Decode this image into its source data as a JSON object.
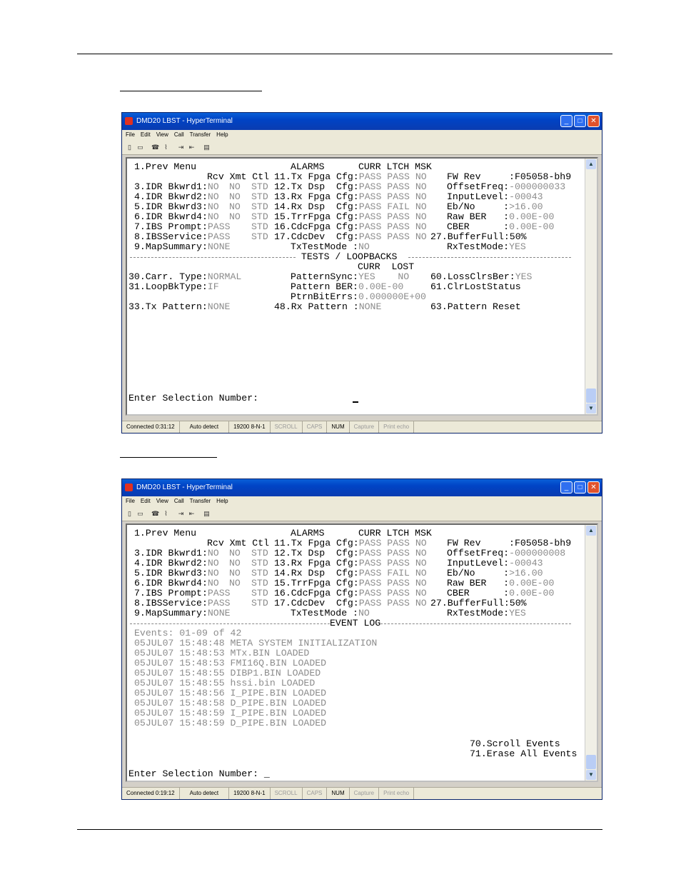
{
  "window1": {
    "title": "DMD20 LBST - HyperTerminal",
    "menu": [
      "File",
      "Edit",
      "View",
      "Call",
      "Transfer",
      "Help"
    ],
    "lines": {
      "prev_menu": "1.Prev Menu",
      "alarms_header": "ALARMS      CURR LTCH MSK",
      "col_header": "Rcv Xmt Ctl",
      "r3_label": "3.IDR Bkwrd1:",
      "r3_a": "NO",
      "r3_b": "NO",
      "r3_c": "STD",
      "r4_label": "4.IDR Bkwrd2:",
      "r4_a": "NO",
      "r4_b": "NO",
      "r4_c": "STD",
      "r5_label": "5.IDR Bkwrd3:",
      "r5_a": "NO",
      "r5_b": "NO",
      "r5_c": "STD",
      "r6_label": "6.IDR Bkwrd4:",
      "r6_a": "NO",
      "r6_b": "NO",
      "r6_c": "STD",
      "r7_label": "7.IBS Prompt:",
      "r7_a": "PASS",
      "r7_c": "STD",
      "r8_label": "8.IBSService:",
      "r8_a": "PASS",
      "r8_c": "STD",
      "r9_label": "9.MapSummary:",
      "r9_a": "NONE",
      "a11": "11.Tx Fpga Cfg:",
      "a11v": "PASS PASS NO",
      "a12": "12.Tx Dsp  Cfg:",
      "a12v": "PASS PASS NO",
      "a13": "13.Rx Fpga Cfg:",
      "a13v": "PASS PASS NO",
      "a14": "14.Rx Dsp  Cfg:",
      "a14v": "PASS FAIL NO",
      "a15": "15.TrrFpga Cfg:",
      "a15v": "PASS PASS NO",
      "a16": "16.CdcFpga Cfg:",
      "a16v": "PASS PASS NO",
      "a17": "17.CdcDev  Cfg:",
      "a17v": "PASS PASS NO",
      "txtest": "TxTestMode :",
      "txtestv": "NO",
      "fw": "FW Rev     :F05058-bh9",
      "offset": "OffsetFreq:",
      "offsetv": "-000000033",
      "input": "InputLevel:",
      "inputv": "-00043",
      "ebno": "Eb/No     :",
      "ebnov": ">16.00",
      "rawber": "Raw BER   :",
      "rawberv": "0.00E-00",
      "cber": "CBER      :",
      "cberv": "0.00E-00",
      "buffer": "27.BufferFull:",
      "bufferv": "50%",
      "rxtest": "RxTestMode:",
      "rxtestv": "YES",
      "divider": " TESTS / LOOPBACKS ",
      "currlost": "CURR  LOST",
      "carr": "30.Carr. Type:",
      "carrv": "NORMAL",
      "loopbk": "31.LoopBkType:",
      "loopbkv": "IF",
      "txpat": "33.Tx Pattern:",
      "txpatv": "NONE",
      "psync": "PatternSync:",
      "psyncv": "YES    NO",
      "pber": "Pattern BER:",
      "pberv": "0.00E-00",
      "pbit": "PtrnBitErrs:",
      "pbitv": "0.000000E+00",
      "rxpat": "48.Rx Pattern :",
      "rxpatv": "NONE",
      "loss": "60.LossClrsBer:",
      "lossv": "YES",
      "clrlost": "61.ClrLostStatus",
      "patreset": "63.Pattern Reset",
      "prompt": "Enter Selection Number:"
    },
    "status": [
      "Connected 0:31:12",
      "Auto detect",
      "19200 8-N-1",
      "SCROLL",
      "CAPS",
      "NUM",
      "Capture",
      "Print echo"
    ]
  },
  "window2": {
    "title": "DMD20 LBST - HyperTerminal",
    "menu": [
      "File",
      "Edit",
      "View",
      "Call",
      "Transfer",
      "Help"
    ],
    "lines": {
      "offsetv": "-000000008",
      "divider": "EVENT LOG",
      "events_header": "Events: 01-09 of 42",
      "events": [
        "05JUL07 15:48:48 META SYSTEM INITIALIZATION",
        "05JUL07 15:48:53 MTx.BIN LOADED",
        "05JUL07 15:48:53 FMI16Q.BIN LOADED",
        "05JUL07 15:48:55 DIBP1.BIN LOADED",
        "05JUL07 15:48:55 hssi.bin LOADED",
        "05JUL07 15:48:56 I_PIPE.BIN LOADED",
        "05JUL07 15:48:58 D_PIPE.BIN LOADED",
        "05JUL07 15:48:59 I_PIPE.BIN LOADED",
        "05JUL07 15:48:59 D_PIPE.BIN LOADED"
      ],
      "scroll": "70.Scroll Events",
      "erase": "71.Erase All Events",
      "prompt": "Enter Selection Number: _"
    },
    "status": [
      "Connected 0:19:12",
      "Auto detect",
      "19200 8-N-1",
      "SCROLL",
      "CAPS",
      "NUM",
      "Capture",
      "Print echo"
    ]
  }
}
